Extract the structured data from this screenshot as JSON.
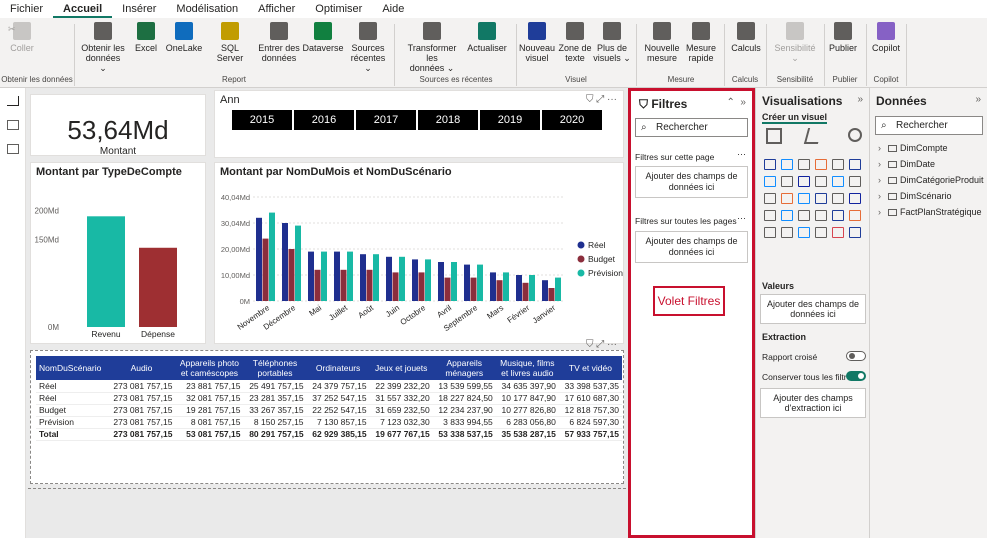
{
  "menu": [
    "Fichier",
    "Accueil",
    "Insérer",
    "Modélisation",
    "Afficher",
    "Optimiser",
    "Aide"
  ],
  "ribbon": {
    "buttons": [
      {
        "label": "Coller",
        "icon": "paste-icon",
        "disabled": true
      },
      {
        "label": "Obtenir les\ndonnées ⌄",
        "icon": "database-icon"
      },
      {
        "label": "Excel",
        "icon": "excel-icon"
      },
      {
        "label": "OneLake",
        "icon": "onelake-icon"
      },
      {
        "label": "SQL Server",
        "icon": "sql-server-icon"
      },
      {
        "label": "Entrer des\ndonnées",
        "icon": "table-icon"
      },
      {
        "label": "Dataverse",
        "icon": "dataverse-icon"
      },
      {
        "label": "Sources\nrécentes ⌄",
        "icon": "recent-sources-icon"
      },
      {
        "label": "Transformer les\ndonnées ⌄",
        "icon": "transform-icon"
      },
      {
        "label": "Actualiser",
        "icon": "refresh-icon"
      },
      {
        "label": "Nouveau\nvisuel",
        "icon": "new-visual-icon"
      },
      {
        "label": "Zone de\ntexte",
        "icon": "text-box-icon"
      },
      {
        "label": "Plus de\nvisuels ⌄",
        "icon": "more-visuals-icon"
      },
      {
        "label": "Nouvelle\nmesure",
        "icon": "new-measure-icon"
      },
      {
        "label": "Mesure\nrapide",
        "icon": "quick-measure-icon"
      },
      {
        "label": "Calculs",
        "icon": "calculator-icon"
      },
      {
        "label": "Sensibilité\n⌄",
        "icon": "sensitivity-icon",
        "disabled": true
      },
      {
        "label": "Publier",
        "icon": "publish-icon"
      },
      {
        "label": "Copilot",
        "icon": "copilot-icon"
      }
    ],
    "groups": [
      "Obtenir les données",
      "Report",
      "Sources es récentes",
      "Visuel",
      "Mesure",
      "Calculs",
      "Sensibilité",
      "Publier",
      "Copilot"
    ]
  },
  "colors": {
    "reel": "#1f2f8f",
    "budget": "#8b2e3c",
    "prevision": "#18b9a5",
    "kpi_revenu": "#18b9a5",
    "kpi_depense": "#9e2f32"
  },
  "kpi": {
    "value": "53,64Md",
    "label": "Montant"
  },
  "slicer": {
    "title": "Ann",
    "years": [
      "2015",
      "2016",
      "2017",
      "2018",
      "2019",
      "2020"
    ]
  },
  "chart_type": {
    "title": "Montant par TypeDeCompte",
    "chart_data": {
      "type": "bar",
      "categories": [
        "Revenu",
        "Dépense"
      ],
      "values": [
        190,
        136
      ],
      "ylim": [
        0,
        230
      ],
      "yticks": [
        "0M",
        "150Md",
        "200Md"
      ],
      "ytick_values": [
        0,
        150,
        200
      ]
    }
  },
  "chart_month": {
    "title": "Montant par NomDuMois et NomDuScénario",
    "legend": [
      "Réel",
      "Budget",
      "Prévision"
    ],
    "chart_data": {
      "type": "bar",
      "categories": [
        "Novembre",
        "Décembre",
        "Mai",
        "Juillet",
        "Août",
        "Juin",
        "Octobre",
        "Avril",
        "Septembre",
        "Mars",
        "Février",
        "Janvier"
      ],
      "series": [
        {
          "name": "Réel",
          "values": [
            32,
            30,
            19,
            19,
            18,
            17,
            16,
            15,
            14,
            11,
            10,
            8
          ]
        },
        {
          "name": "Budget",
          "values": [
            24,
            20,
            12,
            12,
            12,
            11,
            11,
            9,
            9,
            8,
            7,
            5
          ]
        },
        {
          "name": "Prévision",
          "values": [
            34,
            29,
            19,
            19,
            18,
            17,
            16,
            15,
            14,
            11,
            10,
            9
          ]
        }
      ],
      "yticks": [
        "0M",
        "10,00Md",
        "20,00Md",
        "30,04Md",
        "40,04Md"
      ],
      "ytick_values": [
        0,
        10,
        20,
        30,
        40
      ],
      "ylim": [
        0,
        40
      ]
    }
  },
  "table": {
    "headers": [
      "NomDuScénario",
      "Audio",
      "Appareils photo\net caméscopes",
      "Téléphones\nportables",
      "Ordinateurs",
      "Jeux et jouets",
      "Appareils\nménagers",
      "Musique, films\net livres audio",
      "TV et vidéo"
    ],
    "rows": [
      [
        "Réel",
        "273 081 757,15",
        "23 881 757,15",
        "25 491 757,15",
        "24 379 757,15",
        "22 399 232,20",
        "13 539 599,55",
        "34 635 397,90",
        "33 398 537,35"
      ],
      [
        "Réel",
        "273 081 757,15",
        "32 081 757,15",
        "23 281 357,15",
        "37 252 547,15",
        "31 557 332,20",
        "18 227 824,50",
        "10 177 847,90",
        "17 610 687,30"
      ],
      [
        "Budget",
        "273 081 757,15",
        "19 281 757,15",
        "33 267 357,15",
        "22 252 547,15",
        "31 659 232,50",
        "12 234 237,90",
        "10 277 826,80",
        "12 818 757,30"
      ],
      [
        "Prévision",
        "273 081 757,15",
        "8 081 757,15",
        "8 150 257,15",
        "7 130 857,15",
        "7 123 032,30",
        "3 833 994,55",
        "6 283 056,80",
        "6 824 597,30"
      ]
    ],
    "total": [
      "Total",
      "273 081 757,15",
      "53 081 757,15",
      "80 291 757,15",
      "62 929 385,15",
      "19 677 767,15",
      "53 338 537,15",
      "35 538 287,15",
      "57 933 757,15"
    ]
  },
  "filters": {
    "title": "Filtres",
    "search": "Rechercher",
    "page_section": "Filtres sur cette page",
    "all_section": "Filtres sur toutes les pages",
    "add_fields": "Ajouter des champs de données ici",
    "annotation": "Volet Filtres"
  },
  "visualizations": {
    "title": "Visualisations",
    "create": "Créer un visuel",
    "values": "Valeurs",
    "values_drop": "Ajouter des champs de données ici",
    "extraction": "Extraction",
    "cross_report": "Rapport croisé",
    "keep_filters": "Conserver tous les filtres",
    "extraction_drop": "Ajouter des champs d'extraction ici",
    "cross_report_on": false,
    "keep_filters_on": true
  },
  "data_pane": {
    "title": "Données",
    "search": "Rechercher",
    "tables": [
      "DimCompte",
      "DimDate",
      "DimCatégorieProduit",
      "DimScénario",
      "FactPlanStratégique"
    ]
  }
}
